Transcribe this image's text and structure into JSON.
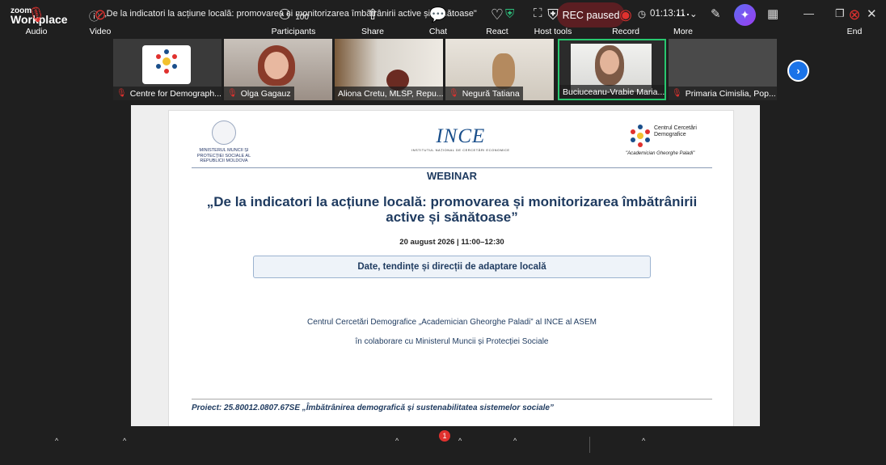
{
  "app": {
    "logo_top": "zoom",
    "logo_bottom": "Workplace",
    "meeting_title": "„De la indicatori la acțiune locală: promovarea și monitorizarea îmbătrânirii active și sănătoase\"",
    "rec_status": "REC paused",
    "timer": "01:13:11"
  },
  "participants": [
    {
      "name": "Centre for Demograph..."
    },
    {
      "name": "Olga Gagauz"
    },
    {
      "name": "Aliona Cretu, MLSP, Repu..."
    },
    {
      "name": "Negură Tatiana"
    },
    {
      "name": "Buciuceanu-Vrabie Maria..."
    },
    {
      "name": "Primaria Cimislia, Pop..."
    }
  ],
  "slide": {
    "ministry": "MINISTERUL MUNCII ȘI PROTECȚIEI SOCIALE AL REPUBLICII MOLDOVA",
    "ince_logo": "INCE",
    "ince_sub": "INSTITUTUL NAȚIONAL DE CERCETĂRI ECONOMICE",
    "ccd_name": "Centrul Cercetări Demografice",
    "ccd_sub": "\"Academician Gheorghe Paladi\"",
    "webinar": "WEBINAR",
    "title": "„De la indicatori la acțiune locală: promovarea și monitorizarea îmbătrânirii active și sănătoase”",
    "date": "20 august 2026 | 11:00–12:30",
    "theme": "Date, tendințe și direcții de adaptare locală",
    "org1": "Centrul Cercetări Demografice „Academician Gheorghe Paladi” al INCE al ASEM",
    "org2": "în colaborare cu Ministerul Muncii și Protecției Sociale",
    "project": "Proiect: 25.80012.0807.67SE „Îmbătrânirea demografică și sustenabilitatea sistemelor sociale”"
  },
  "toolbar": {
    "audio": "Audio",
    "video": "Video",
    "participants": "Participants",
    "participants_count": "100",
    "share": "Share",
    "chat": "Chat",
    "chat_badge": "1",
    "react": "React",
    "host_tools": "Host tools",
    "record": "Record",
    "more": "More",
    "end": "End"
  }
}
